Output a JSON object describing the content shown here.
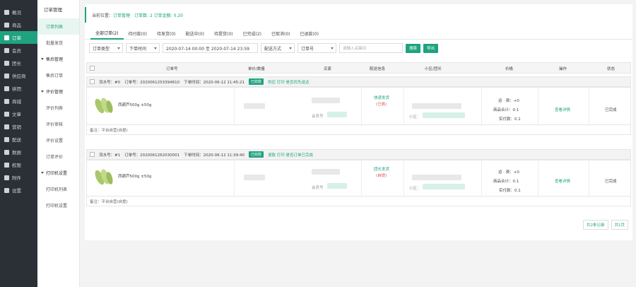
{
  "sidebar": {
    "items": [
      {
        "label": "概况"
      },
      {
        "label": "商品"
      },
      {
        "label": "订单"
      },
      {
        "label": "会员"
      },
      {
        "label": "团长"
      },
      {
        "label": "供应商"
      },
      {
        "label": "拼团"
      },
      {
        "label": "商城"
      },
      {
        "label": "文章"
      },
      {
        "label": "营销"
      },
      {
        "label": "配送"
      },
      {
        "label": "数据"
      },
      {
        "label": "权限"
      },
      {
        "label": "附件"
      },
      {
        "label": "设置"
      }
    ],
    "active_index": 2
  },
  "submenu": {
    "title": "订单管理",
    "items": {
      "order_list": "订单列表",
      "batch_ship": "批量发货"
    },
    "groups": {
      "after_sale": "售后管理",
      "review": "评价管理",
      "printer": "打印机设置"
    },
    "after_sale_items": {
      "refund": "售后订单"
    },
    "review_items": {
      "list": "评价列表",
      "audit": "评价审核",
      "settings": "评价设置",
      "order_review": "订单评价"
    },
    "printer_items": {
      "list": "打印机列表",
      "settings": "打印机设置"
    }
  },
  "breadcrumb": {
    "prefix": "当前位置：",
    "current": "订单管理",
    "count_text": "订单数: 2 订单金额: 0.20"
  },
  "tabs": [
    {
      "label": "全部订单(2)"
    },
    {
      "label": "待付款(0)"
    },
    {
      "label": "待发货(0)"
    },
    {
      "label": "配送中(0)"
    },
    {
      "label": "待提货(0)"
    },
    {
      "label": "已完成(2)"
    },
    {
      "label": "已取消(0)"
    },
    {
      "label": "已退款(0)"
    }
  ],
  "filters": {
    "order_type": "订单类型",
    "time_type": "下单时间",
    "date_range": "2020-07-14 00:00 至 2020-07-14 23:59",
    "delivery": "配送方式",
    "search_field": "订单号",
    "search_placeholder": "请输入关键词",
    "search_btn": "搜索",
    "export_btn": "导出"
  },
  "table_headers": {
    "order": "订单号",
    "price_qty": "单价/数量",
    "buyer": "买家",
    "dispatch": "配送信息",
    "community": "小区/团长",
    "amount": "价格",
    "action": "操作",
    "status": "状态"
  },
  "orders": [
    {
      "serial": "流水号：#0",
      "order_no": "订单号：2020061253394810",
      "order_time": "下单时间：2020-06-12 11:45:21",
      "badge": "已收款",
      "links": "供应  打印  是否优先送达",
      "product_name": "西葫芦500g ±50g",
      "member": "会员号",
      "dispatch_main": "快递发货",
      "dispatch_sub": "(已收)",
      "community": "小区：",
      "fee": "运 · 费：+0",
      "total": "商品合计：0.1",
      "paid": "实付款：0.1",
      "action": "查看详情",
      "status": "已完成",
      "remark": "备注：平台自营(自提)"
    },
    {
      "serial": "流水号：#1",
      "order_no": "订单号：2020061262030001",
      "order_time": "下单时间：2020-06-12 11:39:40",
      "badge": "已收款",
      "links": "退款  打印  是否订单已完成",
      "product_name": "西葫芦500g ±50g",
      "member": "会员号",
      "dispatch_main": "团长发货",
      "dispatch_sub": "(自提)",
      "community": "小区：",
      "fee": "运 · 费：+0",
      "total": "商品合计：0.1",
      "paid": "实付款：0.1",
      "action": "查看详情",
      "status": "已完成",
      "remark": "备注：平台自营(自提)"
    }
  ],
  "pager": {
    "total": "共2条记录",
    "pages": "共1页"
  },
  "colors": {
    "accent": "#1fa37f",
    "sidebar": "#2b2f36"
  }
}
